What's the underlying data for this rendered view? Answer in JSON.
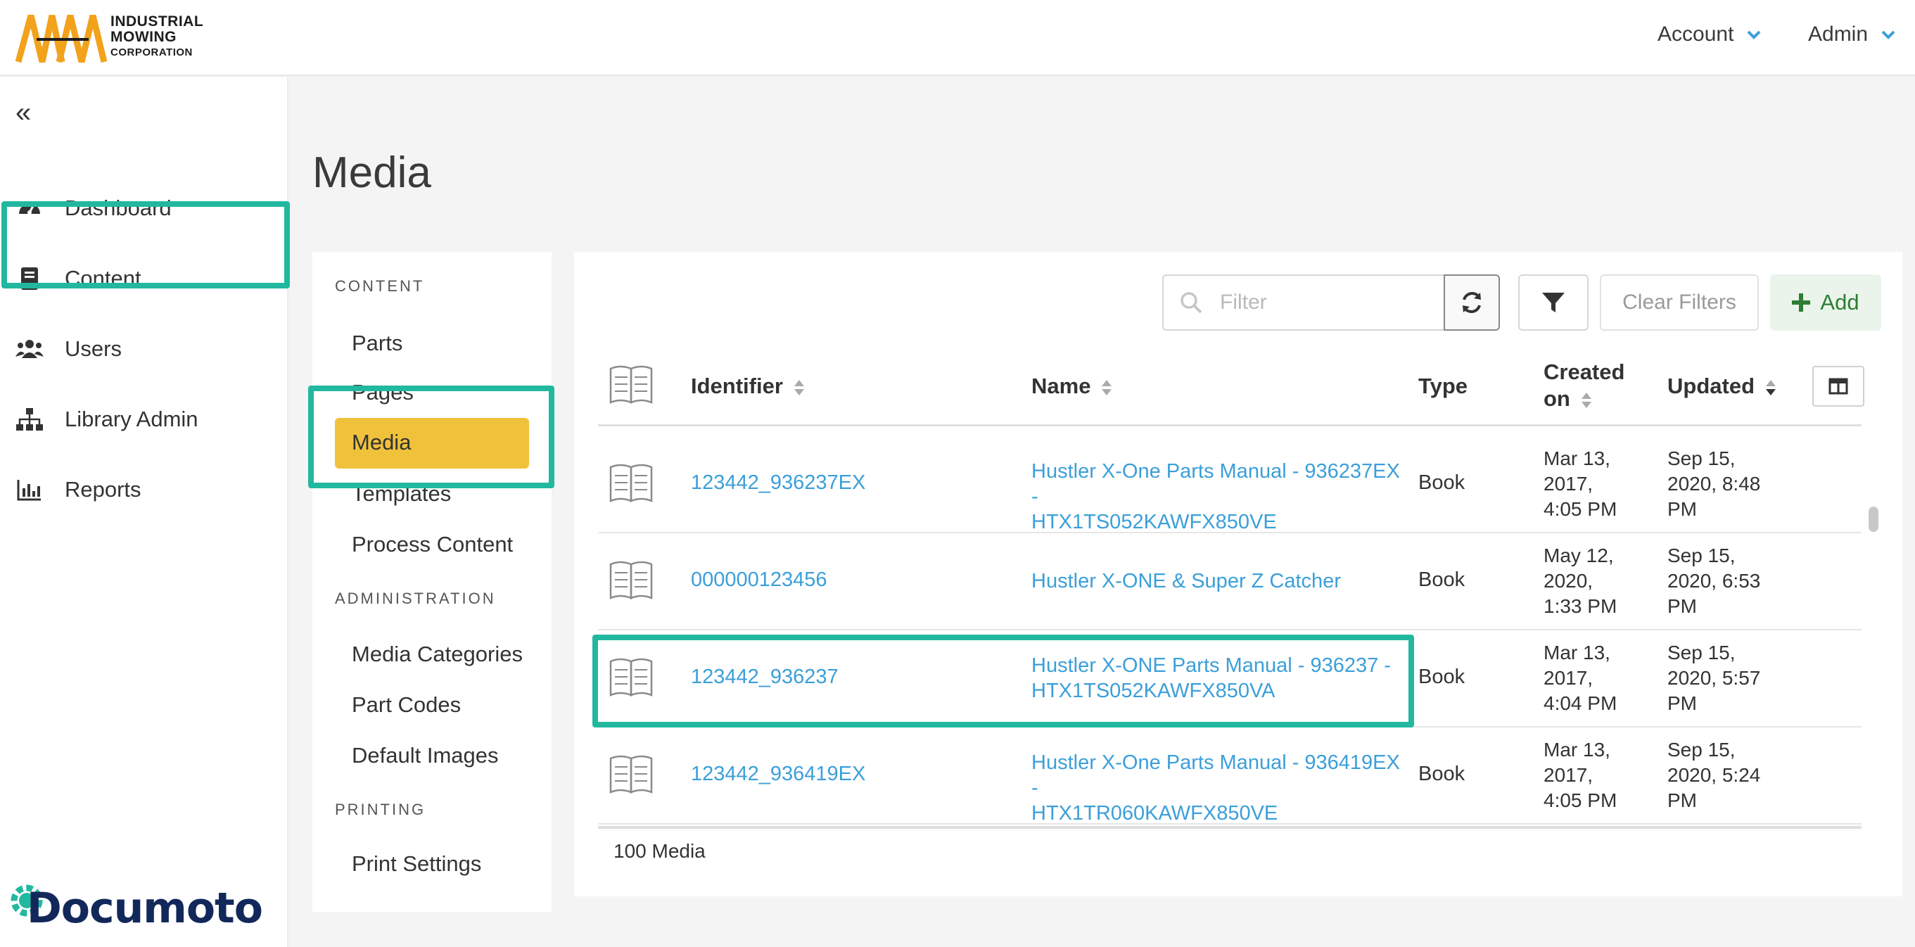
{
  "header": {
    "logo_lines": [
      "INDUSTRIAL",
      "MOWING",
      "CORPORATION"
    ],
    "menu": [
      {
        "label": "Account"
      },
      {
        "label": "Admin"
      }
    ]
  },
  "sidebar": {
    "items": [
      {
        "label": "Dashboard",
        "icon": "gauge-icon"
      },
      {
        "label": "Content",
        "icon": "book-icon"
      },
      {
        "label": "Users",
        "icon": "users-icon"
      },
      {
        "label": "Library Admin",
        "icon": "sitemap-icon"
      },
      {
        "label": "Reports",
        "icon": "chart-icon"
      }
    ],
    "brand": "Documoto"
  },
  "page": {
    "title": "Media"
  },
  "subnav": {
    "sections": [
      {
        "heading": "CONTENT",
        "items": [
          "Parts",
          "Pages",
          "Media",
          "Templates",
          "Process Content"
        ]
      },
      {
        "heading": "ADMINISTRATION",
        "items": [
          "Media Categories",
          "Part Codes",
          "Default Images"
        ]
      },
      {
        "heading": "PRINTING",
        "items": [
          "Print Settings"
        ]
      }
    ],
    "active": "Media"
  },
  "toolbar": {
    "filter_placeholder": "Filter",
    "clear_label": "Clear Filters",
    "add_label": "Add"
  },
  "table": {
    "headers": {
      "identifier": "Identifier",
      "name": "Name",
      "type": "Type",
      "created_1": "Created",
      "created_2": "on",
      "updated": "Updated"
    },
    "rows": [
      {
        "identifier": "123442_936237EX",
        "name_1": "Hustler X-One Parts Manual - 936237EX -",
        "name_2": "HTX1TS052KAWFX850VE",
        "type": "Book",
        "created": [
          "Mar 13,",
          "2017,",
          "4:05 PM"
        ],
        "updated": [
          "Sep 15,",
          "2020, 8:48",
          "PM"
        ]
      },
      {
        "identifier": "000000123456",
        "name_1": "Hustler X-ONE & Super Z Catcher",
        "name_2": "",
        "type": "Book",
        "created": [
          "May 12,",
          "2020,",
          "1:33 PM"
        ],
        "updated": [
          "Sep 15,",
          "2020, 6:53",
          "PM"
        ]
      },
      {
        "identifier": "123442_936237",
        "name_1": "Hustler X-ONE Parts Manual - 936237 -",
        "name_2": "HTX1TS052KAWFX850VA",
        "type": "Book",
        "created": [
          "Mar 13,",
          "2017,",
          "4:04 PM"
        ],
        "updated": [
          "Sep 15,",
          "2020, 5:57",
          "PM"
        ]
      },
      {
        "identifier": "123442_936419EX",
        "name_1": "Hustler X-One Parts Manual - 936419EX -",
        "name_2": "HTX1TR060KAWFX850VE",
        "type": "Book",
        "created": [
          "Mar 13,",
          "2017,",
          "4:05 PM"
        ],
        "updated": [
          "Sep 15,",
          "2020, 5:24",
          "PM"
        ]
      }
    ],
    "count_label": "100 Media"
  },
  "colors": {
    "accent_teal": "#22b8a0",
    "active_yellow": "#f0c23b",
    "link_blue": "#3b9fd9",
    "logo_orange": "#f2a21b"
  }
}
